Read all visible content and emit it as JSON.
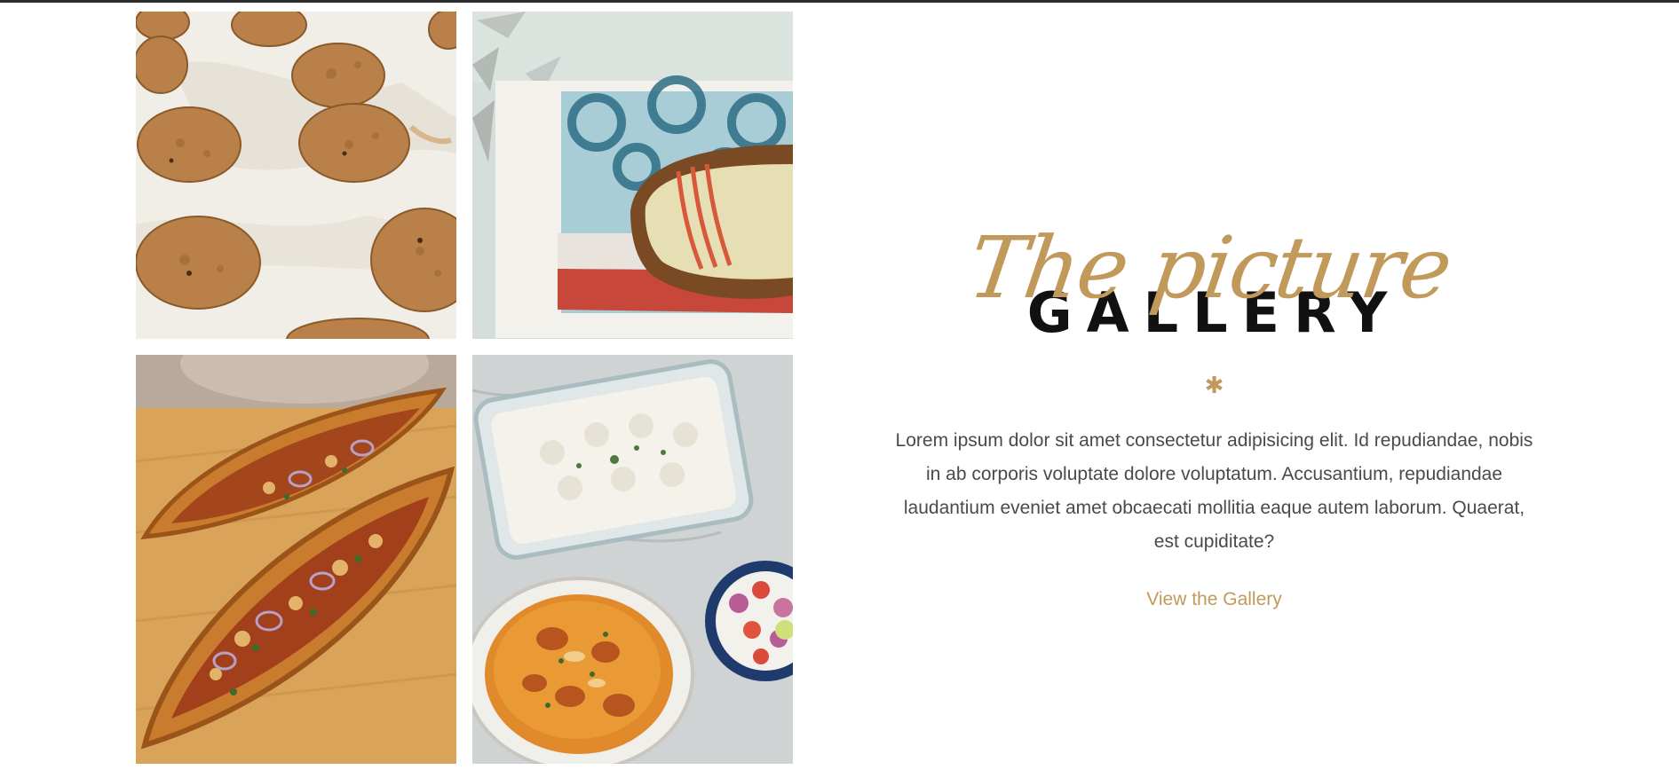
{
  "section": {
    "script_title": "The picture",
    "block_title": "GALLERY",
    "divider_symbol": "✱",
    "body": "Lorem ipsum dolor sit amet consectetur adipisicing elit. Id repudiandae, nobis in ab corporis voluptate dolore voluptatum. Accusantium, repudiandae laudantium eveniet amet obcaecati mollitia eaque autem laborum. Quaerat, est cupiditate?",
    "cta_label": "View the Gallery"
  },
  "gallery": {
    "images": [
      {
        "name": "cookies-photo"
      },
      {
        "name": "custard-pie-photo"
      },
      {
        "name": "pide-flatbread-photo"
      },
      {
        "name": "rice-curry-photo"
      }
    ]
  },
  "colors": {
    "accent": "#c19a5b",
    "heading": "#111111",
    "body_text": "#4a4a4a",
    "top_rule": "#2b2b2b"
  }
}
